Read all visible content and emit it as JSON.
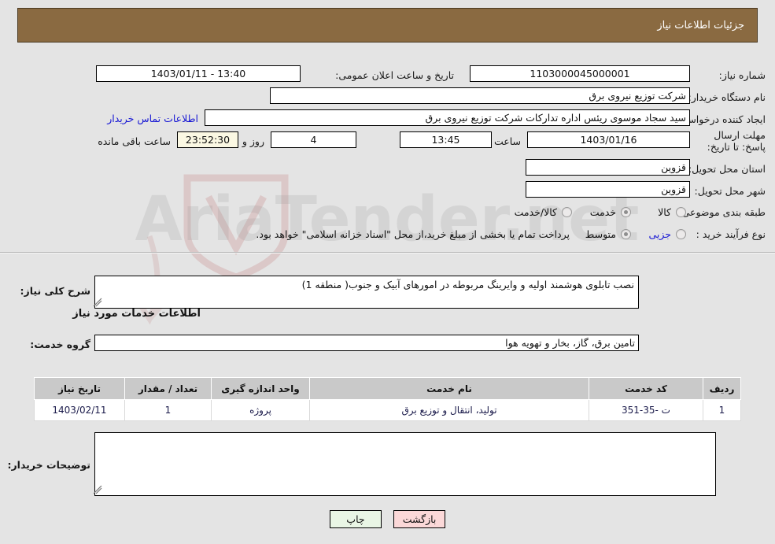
{
  "header": {
    "title": "جزئیات اطلاعات نیاز"
  },
  "form": {
    "need_number_label": "شماره نیاز:",
    "need_number_value": "1103000045000001",
    "announce_label": "تاریخ و ساعت اعلان عمومی:",
    "announce_value": "13:40 - 1403/01/11",
    "buyer_org_label": "نام دستگاه خریدار:",
    "buyer_org_value": "شرکت توزیع نیروی برق",
    "creator_label": "ایجاد کننده درخواست:",
    "creator_value": "سید سجاد موسوی ریئس اداره تدارکات شرکت توزیع نیروی برق",
    "buyer_org_right_value": "شرکت توزیع نیروی برق",
    "contact_link": "اطلاعات تماس خریدار",
    "deadline_label": "مهلت ارسال پاسخ: تا تاریخ:",
    "deadline_date": "1403/01/16",
    "hour_label": "ساعت",
    "deadline_time": "13:45",
    "days_value": "4",
    "days_word": "روز و",
    "countdown": "23:52:30",
    "remaining_word": "ساعت باقی مانده",
    "province_label": "استان محل تحویل:",
    "province_value": "قزوین",
    "city_label": "شهر محل تحویل:",
    "city_value": "قزوین",
    "category_label": "طبقه بندی موضوعی:",
    "category_options": [
      "کالا",
      "خدمت",
      "کالا/خدمت"
    ],
    "category_selected": "خدمت",
    "process_label": "نوع فرآیند خرید :",
    "process_options": [
      "جزیی",
      "متوسط"
    ],
    "process_selected": "متوسط",
    "treasury_note": "پرداخت تمام یا بخشی از مبلغ خرید،از محل \"اسناد خزانه اسلامی\" خواهد بود."
  },
  "summary": {
    "label": "شرح کلی نیاز:",
    "value": "نصب تابلوی هوشمند اولیه و وایرینگ مربوطه در امورهای آبیک و جنوب( منطقه 1)"
  },
  "services_section": {
    "heading": "اطلاعات خدمات مورد نیاز",
    "group_label": "گروه خدمت:",
    "group_value": "تامین برق، گاز، بخار و تهویه هوا"
  },
  "table": {
    "columns": [
      "ردیف",
      "کد خدمت",
      "نام خدمت",
      "واحد اندازه گیری",
      "تعداد / مقدار",
      "تاریخ نیاز"
    ],
    "rows": [
      {
        "row": "1",
        "code": "ت -35-351",
        "name": "تولید، انتقال و توزیع برق",
        "unit": "پروژه",
        "qty": "1",
        "date": "1403/02/11"
      }
    ]
  },
  "buyer_notes": {
    "label": "توضیحات خریدار:",
    "value": ""
  },
  "footer": {
    "print_label": "چاپ",
    "back_label": "بازگشت"
  },
  "watermark": {
    "text": "AriaTender.net"
  },
  "colors": {
    "header_bg": "#8a6a41",
    "page_bg": "#e4e4e4",
    "link": "#1717d4",
    "timer_bg": "#fbf8e3",
    "print_btn": "#e9f6e5",
    "back_btn": "#fbd8d8"
  }
}
